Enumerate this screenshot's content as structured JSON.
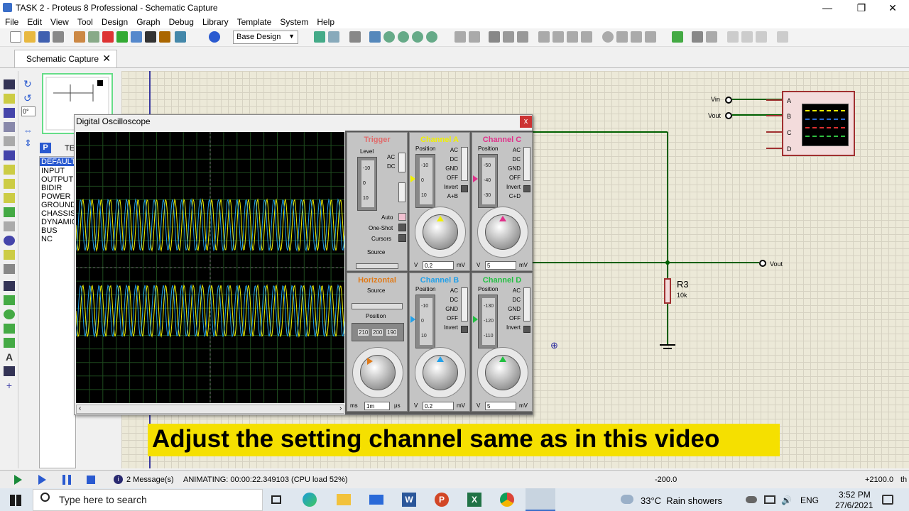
{
  "window": {
    "title": "TASK 2 - Proteus 8 Professional - Schematic Capture"
  },
  "menu": [
    "File",
    "Edit",
    "View",
    "Tool",
    "Design",
    "Graph",
    "Debug",
    "Library",
    "Template",
    "System",
    "Help"
  ],
  "toolbar": {
    "design_select": "Base Design"
  },
  "tab": {
    "label": "Schematic Capture"
  },
  "left_panel": {
    "rotation": "0°",
    "panel_letter": "P",
    "panel_header": "TE",
    "components": [
      "DEFAULT",
      "INPUT",
      "OUTPUT",
      "BIDIR",
      "POWER",
      "GROUND",
      "CHASSIS",
      "DYNAMIC",
      "BUS",
      "NC"
    ]
  },
  "oscilloscope": {
    "title": "Digital Oscilloscope",
    "close": "x",
    "trigger": {
      "title": "Trigger",
      "level_label": "Level",
      "ac": "AC",
      "dc": "DC",
      "auto": "Auto",
      "one_shot": "One-Shot",
      "cursors": "Cursors",
      "source": "Source",
      "scale": [
        "-10",
        "0",
        "10"
      ]
    },
    "channel_a": {
      "title": "Channel A",
      "position_label": "Position",
      "scale": [
        "-10",
        "0",
        "10"
      ],
      "modes": [
        "AC",
        "DC",
        "GND",
        "OFF",
        "Invert",
        "A+B"
      ],
      "value": "0.2",
      "unit_l": "V",
      "unit_r": "mV"
    },
    "channel_c": {
      "title": "Channel C",
      "position_label": "Position",
      "scale": [
        "-50",
        "-40",
        "-30"
      ],
      "modes": [
        "AC",
        "DC",
        "GND",
        "OFF",
        "Invert",
        "C+D"
      ],
      "value": "5",
      "unit_l": "V",
      "unit_r": "mV"
    },
    "horizontal": {
      "title": "Horizontal",
      "source": "Source",
      "position_label": "Position",
      "scale": [
        "210",
        "200",
        "190"
      ],
      "value": "1m",
      "unit_l": "ms",
      "unit_r": "µs"
    },
    "channel_b": {
      "title": "Channel B",
      "position_label": "Position",
      "scale": [
        "-10",
        "0",
        "10"
      ],
      "modes": [
        "AC",
        "DC",
        "GND",
        "OFF",
        "Invert"
      ],
      "value": "0.2",
      "unit_l": "V",
      "unit_r": "mV"
    },
    "channel_d": {
      "title": "Channel D",
      "position_label": "Position",
      "scale": [
        "-130",
        "-120",
        "-110"
      ],
      "modes": [
        "AC",
        "DC",
        "GND",
        "OFF",
        "Invert"
      ],
      "value": "5",
      "unit_l": "V",
      "unit_r": "mV"
    },
    "colors": {
      "a": "#f0f000",
      "b": "#22a0e8",
      "c": "#e0308a",
      "d": "#20c040",
      "horizontal": "#e07a18",
      "trigger": "#e06a6a"
    }
  },
  "schematic": {
    "vin": "Vin",
    "vout_left": "Vout",
    "vout_right": "Vout",
    "pins": [
      "A",
      "B",
      "C",
      "D"
    ],
    "resistor": {
      "name": "R3",
      "value": "10k"
    }
  },
  "caption": "Adjust the setting channel same as in this video",
  "status": {
    "messages": "2 Message(s)",
    "animating": "ANIMATING: 00:00:22.349103 (CPU load 52%)",
    "coord_x": "-200.0",
    "coord_y": "+2100.0",
    "unit": "th"
  },
  "taskbar": {
    "search_placeholder": "Type here to search",
    "weather": "33°C  Rain showers",
    "lang": "ENG",
    "time": "3:52 PM",
    "date": "27/6/2021"
  }
}
